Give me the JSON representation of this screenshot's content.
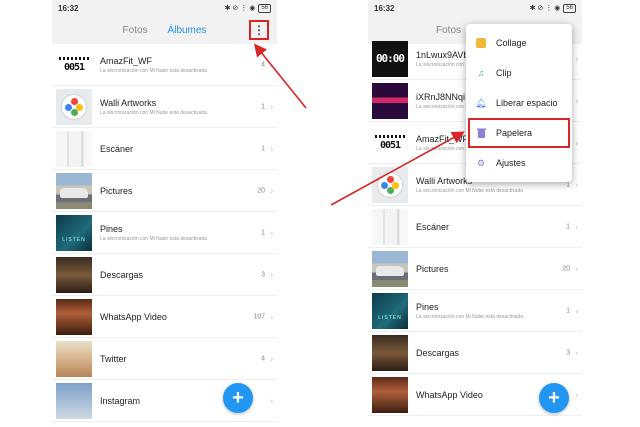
{
  "status": {
    "time": "16:32",
    "icons": "✱ ⊘ ⋮ ◉",
    "battery": "56"
  },
  "tabs": {
    "photos": "Fotos",
    "albums": "Álbumes"
  },
  "sync_notice": "La sincronización con Mi Nube está desactivada",
  "left_albums": [
    {
      "title": "AmazFit_WF",
      "count": "4",
      "sync": true
    },
    {
      "title": "Walli Artworks",
      "count": "1",
      "sync": true
    },
    {
      "title": "Escáner",
      "count": "1",
      "sync": false
    },
    {
      "title": "Pictures",
      "count": "20",
      "sync": false
    },
    {
      "title": "Pines",
      "count": "1",
      "sync": true
    },
    {
      "title": "Descargas",
      "count": "3",
      "sync": false
    },
    {
      "title": "WhatsApp Video",
      "count": "107",
      "sync": false
    },
    {
      "title": "Twitter",
      "count": "4",
      "sync": false
    },
    {
      "title": "Instagram",
      "count": "",
      "sync": false
    }
  ],
  "right_albums": [
    {
      "title": "1nLwux9AVb",
      "count": "",
      "sync": true
    },
    {
      "title": "iXRnJ8NNqi",
      "count": "",
      "sync": true
    },
    {
      "title": "AmazFit_WF",
      "count": "",
      "sync": true
    },
    {
      "title": "Walli Artworks",
      "count": "1",
      "sync": true
    },
    {
      "title": "Escáner",
      "count": "1",
      "sync": false
    },
    {
      "title": "Pictures",
      "count": "20",
      "sync": false
    },
    {
      "title": "Pines",
      "count": "1",
      "sync": true
    },
    {
      "title": "Descargas",
      "count": "3",
      "sync": false
    },
    {
      "title": "WhatsApp Video",
      "count": "",
      "sync": false
    }
  ],
  "thumb_texts": {
    "watch": "00:00",
    "watch_white": "0051",
    "pines": "LISTEN"
  },
  "menu": {
    "collage": "Collage",
    "clip": "Clip",
    "remove_space": "Liberar espacio",
    "trash": "Papelera",
    "settings": "Ajustes"
  },
  "colors": {
    "accent": "#1f8ff0",
    "fab": "#2196f3",
    "highlight": "#d62626"
  },
  "icons": {
    "menu": "more-vertical-icon",
    "fab": "plus-icon",
    "collage": "collage-icon",
    "clip": "clip-icon",
    "remove_space": "bell-icon",
    "trash": "trash-icon",
    "settings": "gear-icon"
  }
}
